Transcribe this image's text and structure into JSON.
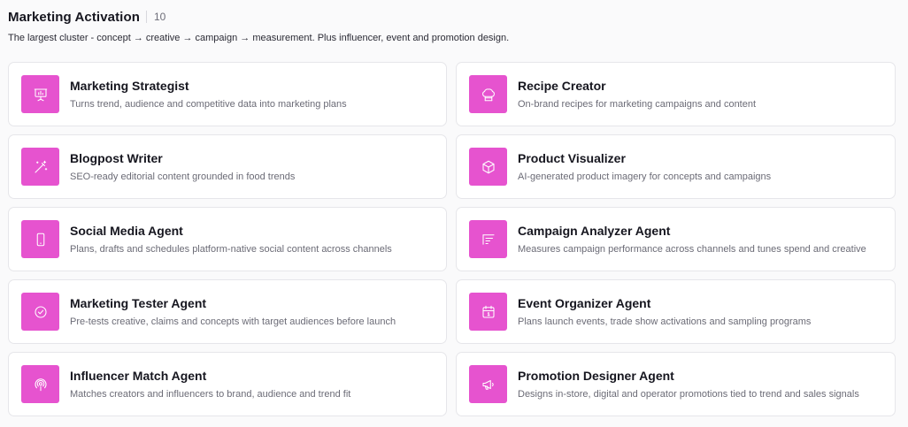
{
  "section": {
    "title": "Marketing Activation",
    "count": "10",
    "description": "The largest cluster - concept → creative → campaign → measurement. Plus influencer, event and promotion design."
  },
  "theme": {
    "accent": "#e653cf",
    "card_border": "#e6e6ea",
    "title_color": "#16161f",
    "desc_color": "#6b6b76"
  },
  "agents": [
    {
      "title": "Marketing Strategist",
      "desc": "Turns trend, audience and competitive data into marketing plans",
      "icon": "presentation-icon"
    },
    {
      "title": "Recipe Creator",
      "desc": "On-brand recipes for marketing campaigns and content",
      "icon": "chef-hat-icon"
    },
    {
      "title": "Blogpost Writer",
      "desc": "SEO-ready editorial content grounded in food trends",
      "icon": "magic-wand-icon"
    },
    {
      "title": "Product Visualizer",
      "desc": "AI-generated product imagery for concepts and campaigns",
      "icon": "package-icon"
    },
    {
      "title": "Social Media Agent",
      "desc": "Plans, drafts and schedules platform-native social content across channels",
      "icon": "smartphone-icon"
    },
    {
      "title": "Campaign Analyzer Agent",
      "desc": "Measures campaign performance across channels and tunes spend and creative",
      "icon": "report-icon"
    },
    {
      "title": "Marketing Tester Agent",
      "desc": "Pre-tests creative, claims and concepts with target audiences before launch",
      "icon": "check-circle-icon"
    },
    {
      "title": "Event Organizer Agent",
      "desc": "Plans launch events, trade show activations and sampling programs",
      "icon": "calendar-icon"
    },
    {
      "title": "Influencer Match Agent",
      "desc": "Matches creators and influencers to brand, audience and trend fit",
      "icon": "podcast-icon"
    },
    {
      "title": "Promotion Designer Agent",
      "desc": "Designs in-store, digital and operator promotions tied to trend and sales signals",
      "icon": "megaphone-icon"
    }
  ]
}
